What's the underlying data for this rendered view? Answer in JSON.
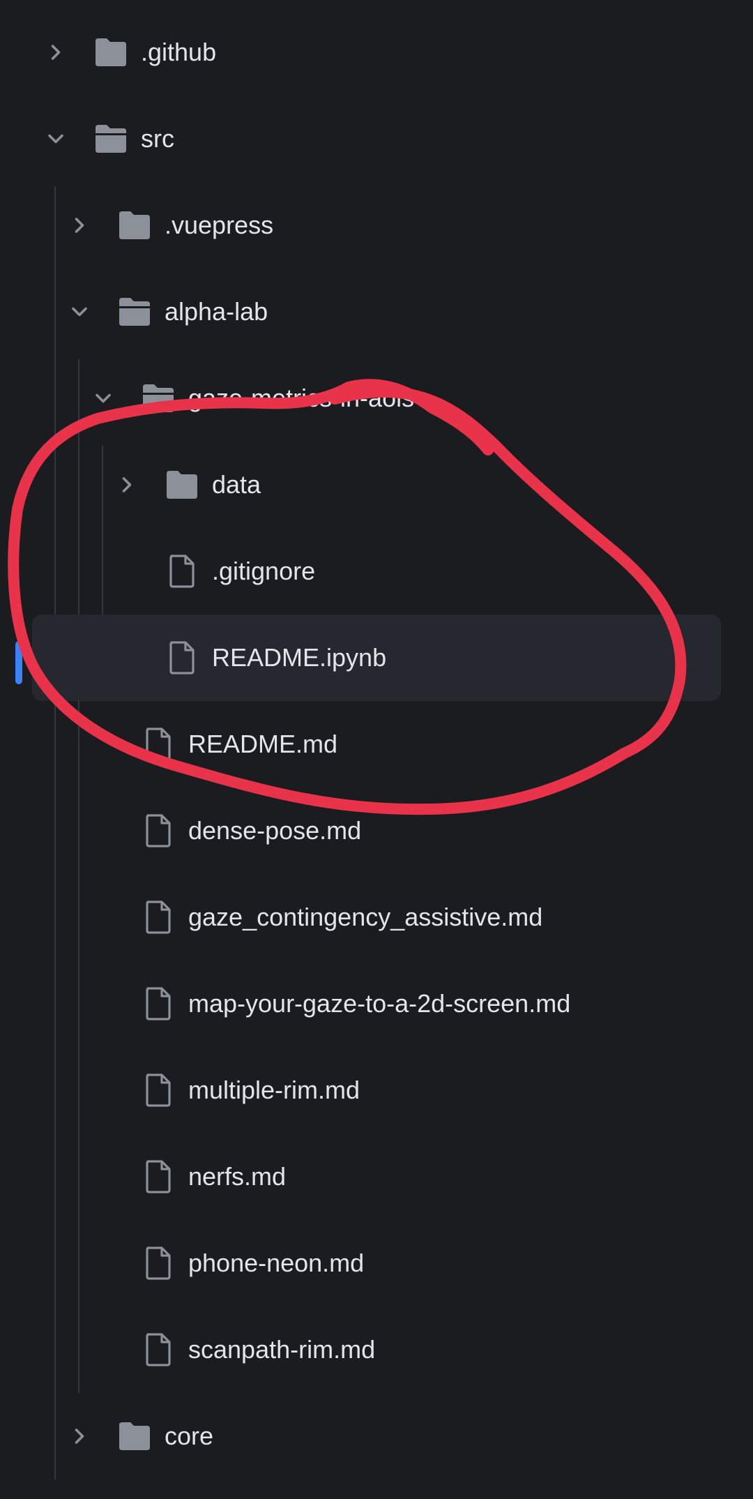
{
  "explorer": {
    "items": [
      {
        "label": ".github",
        "kind": "folder",
        "depth": 0,
        "state": "collapsed",
        "icon": "folder-icon"
      },
      {
        "label": "src",
        "kind": "folder",
        "depth": 0,
        "state": "expanded",
        "icon": "folder-open-icon"
      },
      {
        "label": ".vuepress",
        "kind": "folder",
        "depth": 1,
        "state": "collapsed",
        "icon": "folder-icon"
      },
      {
        "label": "alpha-lab",
        "kind": "folder",
        "depth": 1,
        "state": "expanded",
        "icon": "folder-open-icon"
      },
      {
        "label": "gaze-metrics-in-aois",
        "kind": "folder",
        "depth": 2,
        "state": "expanded",
        "icon": "folder-open-icon"
      },
      {
        "label": "data",
        "kind": "folder",
        "depth": 3,
        "state": "collapsed",
        "icon": "folder-icon"
      },
      {
        "label": ".gitignore",
        "kind": "file",
        "depth": 3,
        "icon": "file-icon"
      },
      {
        "label": "README.ipynb",
        "kind": "file",
        "depth": 3,
        "icon": "file-icon",
        "selected": true
      },
      {
        "label": "README.md",
        "kind": "file",
        "depth": 2,
        "icon": "file-icon"
      },
      {
        "label": "dense-pose.md",
        "kind": "file",
        "depth": 2,
        "icon": "file-icon"
      },
      {
        "label": "gaze_contingency_assistive.md",
        "kind": "file",
        "depth": 2,
        "icon": "file-icon"
      },
      {
        "label": "map-your-gaze-to-a-2d-screen.md",
        "kind": "file",
        "depth": 2,
        "icon": "file-icon"
      },
      {
        "label": "multiple-rim.md",
        "kind": "file",
        "depth": 2,
        "icon": "file-icon"
      },
      {
        "label": "nerfs.md",
        "kind": "file",
        "depth": 2,
        "icon": "file-icon"
      },
      {
        "label": "phone-neon.md",
        "kind": "file",
        "depth": 2,
        "icon": "file-icon"
      },
      {
        "label": "scanpath-rim.md",
        "kind": "file",
        "depth": 2,
        "icon": "file-icon"
      },
      {
        "label": "core",
        "kind": "folder",
        "depth": 1,
        "state": "collapsed",
        "icon": "folder-icon"
      }
    ]
  },
  "annotation": {
    "shape": "hand-drawn circle",
    "color": "#e8334a"
  },
  "colors": {
    "background": "#1a1c20",
    "text": "#e3e5ea",
    "icon": "#8b9099",
    "selected_background": "#25282e",
    "selection_indicator": "#3b82f6"
  }
}
